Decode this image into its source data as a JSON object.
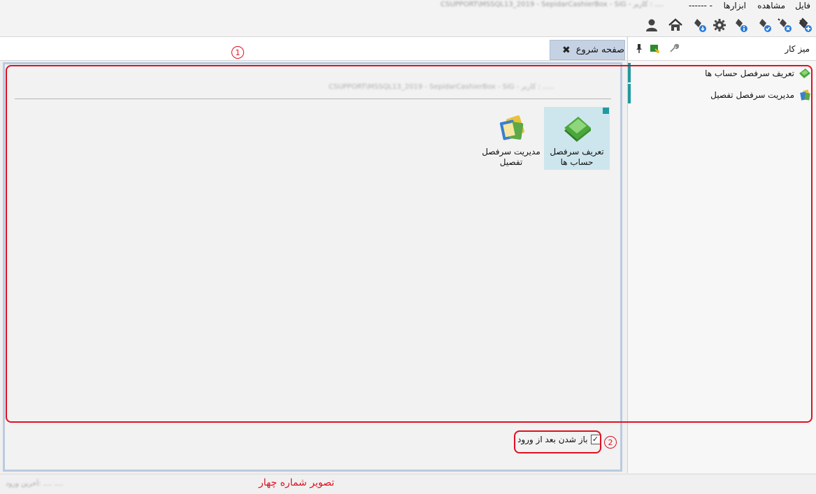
{
  "menu": {
    "items": [
      "فایل",
      "مشاهده",
      "ابزارها",
      "------ -"
    ],
    "title": "CSUPPORT\\MSSQL13_2019 - SepidarCashierBox - SiG - کاربر : ...."
  },
  "toolbar": {
    "icons": [
      "plug-add-icon",
      "plug-remove-icon",
      "plug-check-icon",
      "plug-info-icon",
      "settings-icon",
      "plug-download-icon",
      "home-icon",
      "user-icon"
    ]
  },
  "tabs": [
    {
      "label": "صفحه شروع",
      "close": "✖"
    }
  ],
  "main": {
    "header": "CSUPPORT\\MSSQL13_2019 - SepidarCashierBox - SiG - کاربر : .....",
    "tiles": [
      {
        "label": "تعریف سرفصل حساب ها"
      },
      {
        "label": "مدیریت سرفصل تفصیل"
      }
    ],
    "checkbox": {
      "label": "باز شدن بعد از ورود",
      "checked": true,
      "mark": "✓"
    }
  },
  "side": {
    "title": "میز کار",
    "items": [
      {
        "label": "تعریف سرفصل حساب ها"
      },
      {
        "label": "مدیریت سرفصل تفصیل"
      }
    ]
  },
  "annotations": {
    "n1": "1",
    "n2": "2",
    "caption": "تصویر شماره چهار"
  },
  "status": {
    "text": "آخرین ورود: .... ...."
  },
  "colors": {
    "accent": "#1f9aa0",
    "tab_bg": "#c5d2e4",
    "annotation": "#e01020",
    "tile_selected": "#cde6ed"
  }
}
